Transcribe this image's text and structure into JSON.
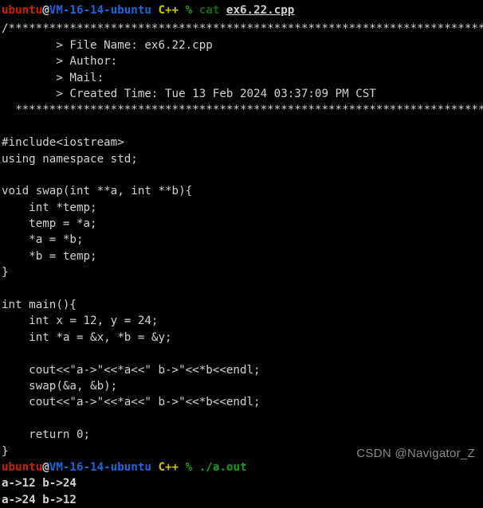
{
  "terminal": {
    "background_color": "#000000",
    "default_text_color": "#d2d2d2",
    "prompt_colors": {
      "user": "#cc2200",
      "at": "#d2d2d2",
      "host": "#1c66e0",
      "shell_label": "#d4c400",
      "percent": "#19a019",
      "command": "#0d6b0d",
      "filename": "#d2d2d2",
      "executable": "#19a019"
    },
    "prompt1": {
      "user": "ubuntu",
      "at": "@",
      "host": "VM-16-14-ubuntu",
      "shell_label": "C++",
      "percent": "%",
      "command": "cat",
      "argument": "ex6.22.cpp"
    },
    "prompt2": {
      "user": "ubuntu",
      "at": "@",
      "host": "VM-16-14-ubuntu",
      "shell_label": "C++",
      "percent": "%",
      "command": "./a.out"
    },
    "file_header": {
      "top_rule": "/************************************************************************",
      "rows": [
        "        > File Name: ex6.22.cpp",
        "        > Author: ",
        "        > Mail: ",
        "        > Created Time: Tue 13 Feb 2024 03:37:09 PM CST"
      ],
      "bottom_rule": "  ************************************************************************/"
    },
    "source_code": [
      "",
      "#include<iostream>",
      "using namespace std;",
      "",
      "void swap(int **a, int **b){",
      "    int *temp;",
      "    temp = *a;",
      "    *a = *b;",
      "    *b = temp;",
      "}",
      "",
      "int main(){",
      "    int x = 12, y = 24;",
      "    int *a = &x, *b = &y;",
      "",
      "    cout<<\"a->\"<<*a<<\" b->\"<<*b<<endl;",
      "    swap(&a, &b);",
      "    cout<<\"a->\"<<*a<<\" b->\"<<*b<<endl;",
      "",
      "    return 0;",
      "}"
    ],
    "program_output": [
      "a->12 b->24",
      "a->24 b->12"
    ]
  },
  "watermark": {
    "text": "CSDN @Navigator_Z",
    "color": "#8a8a8a"
  }
}
